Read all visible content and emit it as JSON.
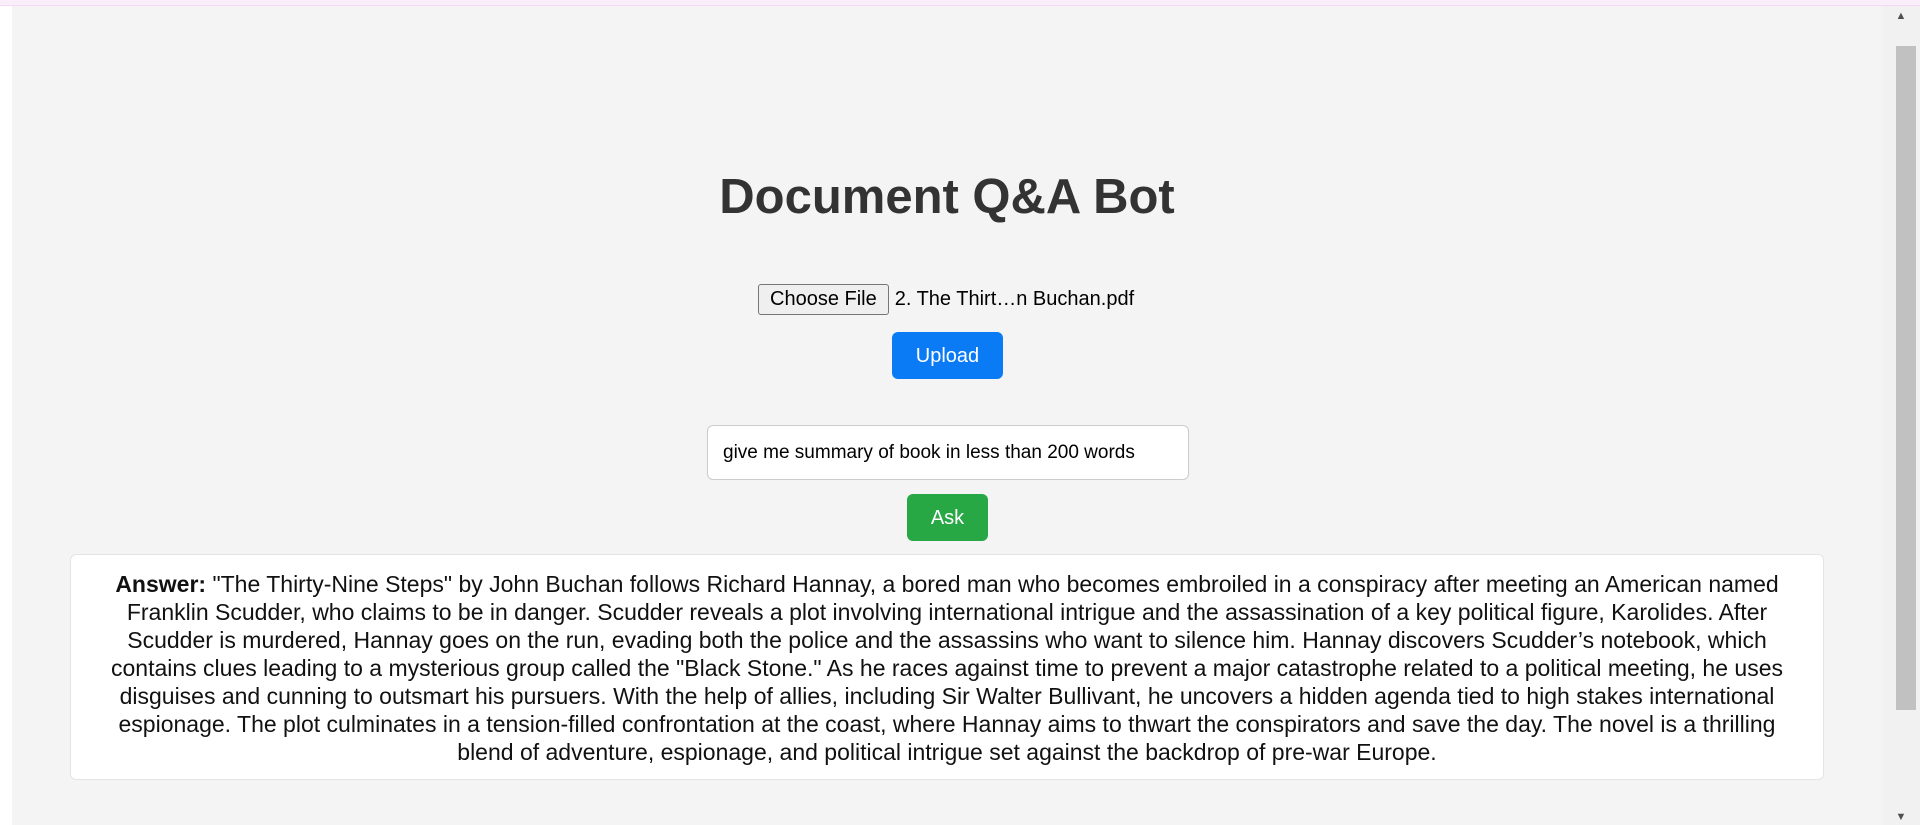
{
  "page": {
    "title": "Document Q&A Bot"
  },
  "upload": {
    "choose_file_label": "Choose File",
    "file_name": "2. The Thirt…n Buchan.pdf",
    "upload_label": "Upload"
  },
  "question": {
    "value": "give me summary of book in less than 200 words"
  },
  "ask": {
    "label": "Ask"
  },
  "answer": {
    "label": "Answer:",
    "text": "\"The Thirty-Nine Steps\" by John Buchan follows Richard Hannay, a bored man who becomes embroiled in a conspiracy after meeting an American named Franklin Scudder, who claims to be in danger. Scudder reveals a plot involving international intrigue and the assassination of a key political figure, Karolides. After Scudder is murdered, Hannay goes on the run, evading both the police and the assassins who want to silence him. Hannay discovers Scudder’s notebook, which contains clues leading to a mysterious group called the \"Black Stone.\" As he races against time to prevent a major catastrophe related to a political meeting, he uses disguises and cunning to outsmart his pursuers. With the help of allies, including Sir Walter Bullivant, he uncovers a hidden agenda tied to high stakes international espionage. The plot culminates in a tension-filled confrontation at the coast, where Hannay aims to thwart the conspirators and save the day. The novel is a thrilling blend of adventure, espionage, and political intrigue set against the backdrop of pre-war Europe."
  },
  "colors": {
    "upload_button": "#0a7bf5",
    "ask_button": "#28a745",
    "page_background": "#f4f4f4",
    "title": "#333333"
  },
  "icons": {
    "scroll_up": "triangle-up",
    "scroll_down": "triangle-down"
  }
}
